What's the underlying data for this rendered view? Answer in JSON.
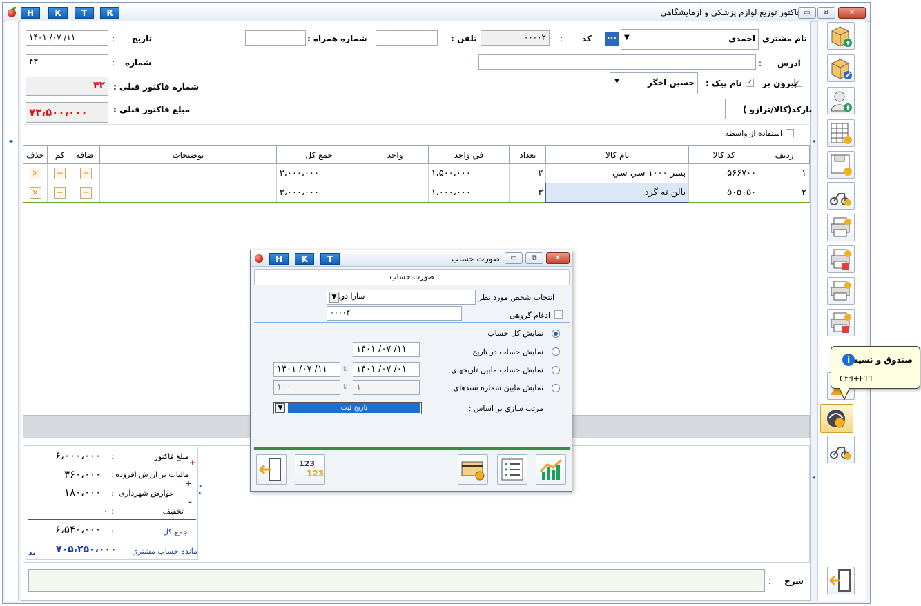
{
  "window": {
    "title": "فاکتور توزيع لوازم پزشکي و آزمايشگاهي",
    "hkt": [
      "H",
      "K",
      "T",
      "R"
    ]
  },
  "header": {
    "customer_label": "نام مشتري :",
    "customer_value": "احمدی",
    "code_label": "کد",
    "code_colon": ":",
    "code_value": "۰۰۰۰۲",
    "phone_label": "تلفن :",
    "phone_value": "",
    "mobile_label": "شماره همراه :",
    "mobile_value": "",
    "date_label": "تاريخ",
    "date_colon": ":",
    "date_value": "۱۴۰۱  /۰۷  /۱۱",
    "address_label": "آدرس",
    "address_colon": ":",
    "address_value": "",
    "number_label": "شماره",
    "number_colon": ":",
    "number_value": "۴۳",
    "outgoing_label": "بيرون بر",
    "courier_label": "نام پيک :",
    "courier_value": "حسين اخگر",
    "prev_invoice_label": "شماره فاکتور قبلی :",
    "prev_invoice_value": "۴۲",
    "barcode_label": "بارکد(کالا/ترازو )",
    "prev_amount_label": "مبلغ فاکتور قبلی :",
    "prev_amount_value": "۷۳،۵۰۰،۰۰۰",
    "intermediary_label": "استفاده از واسطه"
  },
  "grid": {
    "columns": [
      "رديف",
      "کد کالا",
      "نام کالا",
      "تعداد",
      "في واحد",
      "واحد",
      "جمع کل",
      "توضيحات",
      "اضافه",
      "کم",
      "حذف"
    ],
    "rows": [
      {
        "row": "۱",
        "code": "۵۶۶۷۰۰",
        "name": "بشر ۱۰۰۰ سي سي",
        "qty": "۲",
        "unit_price": "۱،۵۰۰،۰۰۰",
        "unit": "",
        "total": "۳،۰۰۰،۰۰۰",
        "desc": ""
      },
      {
        "row": "۲",
        "code": "۵۰۵۰۵۰",
        "name": "بالن ته گرد",
        "qty": "۳",
        "unit_price": "۱،۰۰۰،۰۰۰",
        "unit": "",
        "total": "۳،۰۰۰،۰۰۰",
        "desc": ""
      }
    ],
    "plus": "+",
    "minus": "−",
    "del": "×"
  },
  "summary": {
    "invoice_amount_label": "مبلغ فاکتور",
    "invoice_amount_value": "۶،۰۰۰،۰۰۰",
    "vat_label": "ماليات بر ارزش افزوده",
    "vat_value": "۳۶۰،۰۰۰",
    "municipal_label": "عوارض شهرداری",
    "municipal_value": "۱۸۰،۰۰۰",
    "discount_label": "تخفيف",
    "discount_value": "۰",
    "total_label": "جمع کل",
    "total_value": "۶،۵۴۰،۰۰۰",
    "balance_label": "مانده حساب مشتري",
    "balance_value": "۷۰۵،۲۵۰،۰۰۰",
    "balance_tag": "بد",
    "colon": ":",
    "plus": "+",
    "minus": "-"
  },
  "footer": {
    "notes_label": "شرح",
    "notes_colon": ":"
  },
  "dialog": {
    "title": "صورت حساب",
    "hkt": [
      "H",
      "K",
      "T"
    ],
    "header": "صورت حساب",
    "person_label": "انتخاب شخص مورد نظر",
    "person_value": "سارا دولتی",
    "group_label": "ادغام گروهی",
    "group_value": "۰۰۰۰۴",
    "opt_all": "نمايش کل حساب",
    "opt_date": "نمايش حساب در تاريخ",
    "opt_range": "نمايش حساب مابين تاريخهای",
    "opt_docs": "نمايش مابين شماره سندهای",
    "date_single": "۱۴۰۱  /۰۷  /۱۱",
    "range_from": "۱۴۰۱  /۰۷  /۰۱",
    "range_to": "۱۴۰۱  /۰۷  /۱۱",
    "range_sep": "تا",
    "doc_from": "۱",
    "doc_to": "۱۰۰",
    "sort_label": "مرتب سازي بر اساس   :",
    "sort_value": "تاريخ ثبت",
    "btn_123_top": "123",
    "btn_123_bottom": "123"
  },
  "tooltip": {
    "title": "صندوق و نسيه",
    "shortcut": "Ctrl+F11"
  },
  "colors": {
    "accent_blue": "#1a6fd0",
    "red": "#e01010",
    "summary_blue": "#1a3ab8"
  }
}
